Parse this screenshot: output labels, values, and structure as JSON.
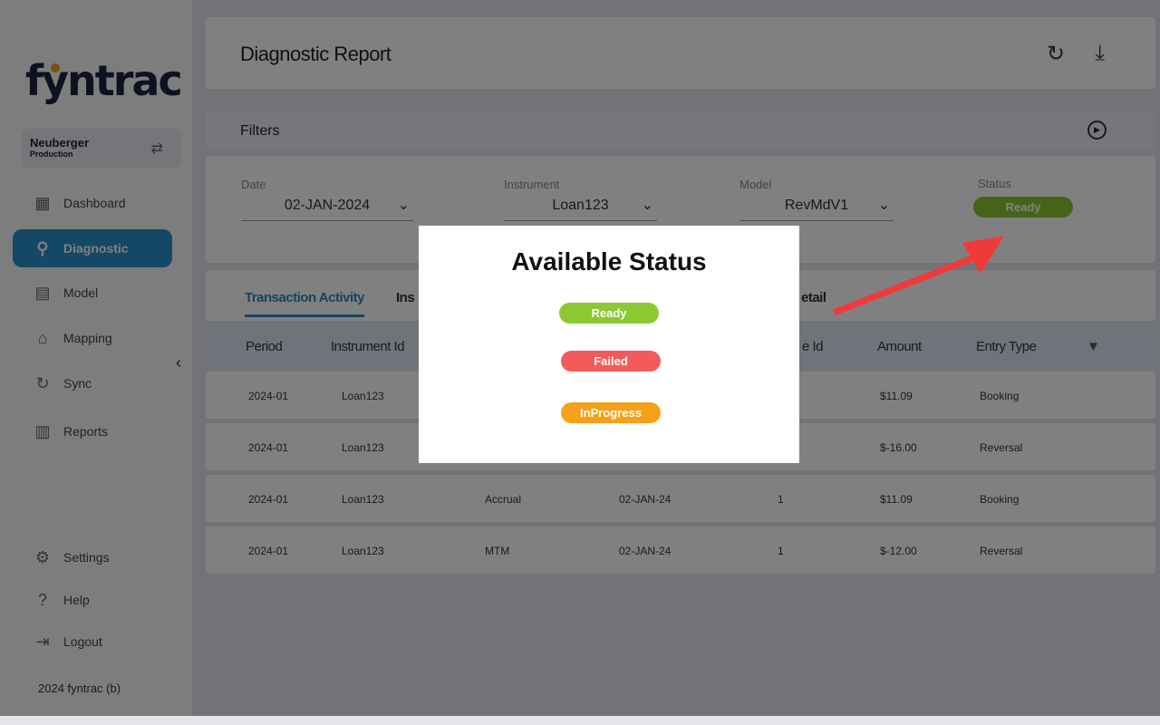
{
  "sidebar": {
    "brand": "fyntrac",
    "org": "Neuberger",
    "env": "Production",
    "items": [
      {
        "label": "Dashboard",
        "icon": "grid-icon"
      },
      {
        "label": "Diagnostic",
        "icon": "search-icon"
      },
      {
        "label": "Model",
        "icon": "book-icon"
      },
      {
        "label": "Mapping",
        "icon": "warehouse-icon"
      },
      {
        "label": "Sync",
        "icon": "sync-icon"
      },
      {
        "label": "Reports",
        "icon": "report-icon"
      }
    ],
    "bottom": [
      {
        "label": "Settings"
      },
      {
        "label": "Help"
      },
      {
        "label": "Logout"
      }
    ],
    "copyright": "2024 fyntrac (b)"
  },
  "header": {
    "title": "Diagnostic Report"
  },
  "filters": {
    "label": "Filters",
    "date": {
      "label": "Date",
      "value": "02-JAN-2024"
    },
    "instrument": {
      "label": "Instrument",
      "value": "Loan123"
    },
    "model": {
      "label": "Model",
      "value": "RevMdV1"
    },
    "status": {
      "label": "Status",
      "value": "Ready"
    }
  },
  "tabs": [
    "Transaction Activity",
    "Ins",
    "etail"
  ],
  "columns": [
    "Period",
    "Instrument Id",
    "e Id",
    "Amount",
    "Entry Type"
  ],
  "rows": [
    {
      "period": "2024-01",
      "instrument": "Loan123",
      "type": "",
      "date": "",
      "id": "",
      "amount": "$11.09",
      "entry": "Booking"
    },
    {
      "period": "2024-01",
      "instrument": "Loan123",
      "type": "",
      "date": "",
      "id": "",
      "amount": "$-16.00",
      "entry": "Reversal"
    },
    {
      "period": "2024-01",
      "instrument": "Loan123",
      "type": "Accrual",
      "date": "02-JAN-24",
      "id": "1",
      "amount": "$11.09",
      "entry": "Booking"
    },
    {
      "period": "2024-01",
      "instrument": "Loan123",
      "type": "MTM",
      "date": "02-JAN-24",
      "id": "1",
      "amount": "$-12.00",
      "entry": "Reversal"
    }
  ],
  "modal": {
    "title": "Available Status",
    "statuses": [
      {
        "label": "Ready",
        "color": "#8cc832"
      },
      {
        "label": "Failed",
        "color": "#f45a5a"
      },
      {
        "label": "InProgress",
        "color": "#f5a019"
      }
    ]
  },
  "colors": {
    "accent": "#2a90c8",
    "arrow": "#f03a3a"
  }
}
